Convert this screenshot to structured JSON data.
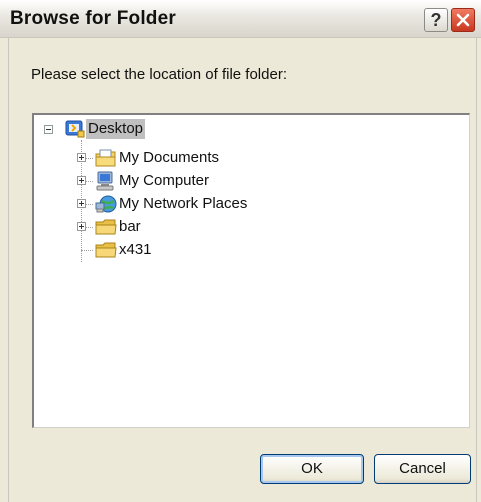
{
  "window": {
    "title": "Browse for Folder",
    "help_glyph": "?"
  },
  "prompt": "Please select the location of file folder:",
  "tree": {
    "root": {
      "label": "Desktop",
      "icon": "desktop-icon",
      "selected": true,
      "expanded": true
    },
    "children": [
      {
        "label": "My Documents",
        "icon": "my-documents-icon",
        "has_children": true
      },
      {
        "label": "My Computer",
        "icon": "my-computer-icon",
        "has_children": true
      },
      {
        "label": "My Network Places",
        "icon": "network-places-icon",
        "has_children": true
      },
      {
        "label": "bar",
        "icon": "folder-icon",
        "has_children": true
      },
      {
        "label": "x431",
        "icon": "folder-icon",
        "has_children": false
      }
    ]
  },
  "buttons": {
    "ok": "OK",
    "cancel": "Cancel"
  },
  "colors": {
    "dialog_bg": "#ece9d8",
    "close_red": "#c8381f",
    "selection": "#c0c0c0",
    "folder_yellow": "#f5d36a"
  }
}
